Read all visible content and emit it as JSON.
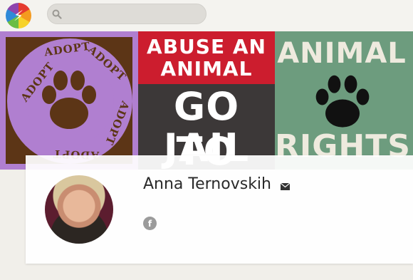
{
  "header": {
    "logo_icon": "lightning-bolt-icon",
    "search": {
      "value": "",
      "placeholder": "",
      "icon": "search-icon"
    }
  },
  "cover": {
    "adopt_panel": {
      "ring_words": [
        "ADOPT",
        "ADOPT",
        "ADOPT",
        "ADOPT",
        "ADOPT"
      ],
      "icon": "paw-icon",
      "bg_color": "#b07fd0",
      "accent_color": "#5c3516"
    },
    "abuse_panel": {
      "line1": "ABUSE AN",
      "line2": "ANIMAL",
      "line3": "GO TO",
      "line4": "JAIL",
      "top_color": "#cc1d2e",
      "bottom_color": "#3c3838"
    },
    "rights_panel": {
      "line1": "ANIMAL",
      "line2": "RIGHTS",
      "icon": "paw-icon",
      "bg_color": "#6d9c7e"
    }
  },
  "profile": {
    "name": "Anna Ternovskih",
    "contact_icon": "mail-icon",
    "social": [
      {
        "network": "facebook",
        "icon": "facebook-icon",
        "glyph": "f"
      }
    ]
  }
}
